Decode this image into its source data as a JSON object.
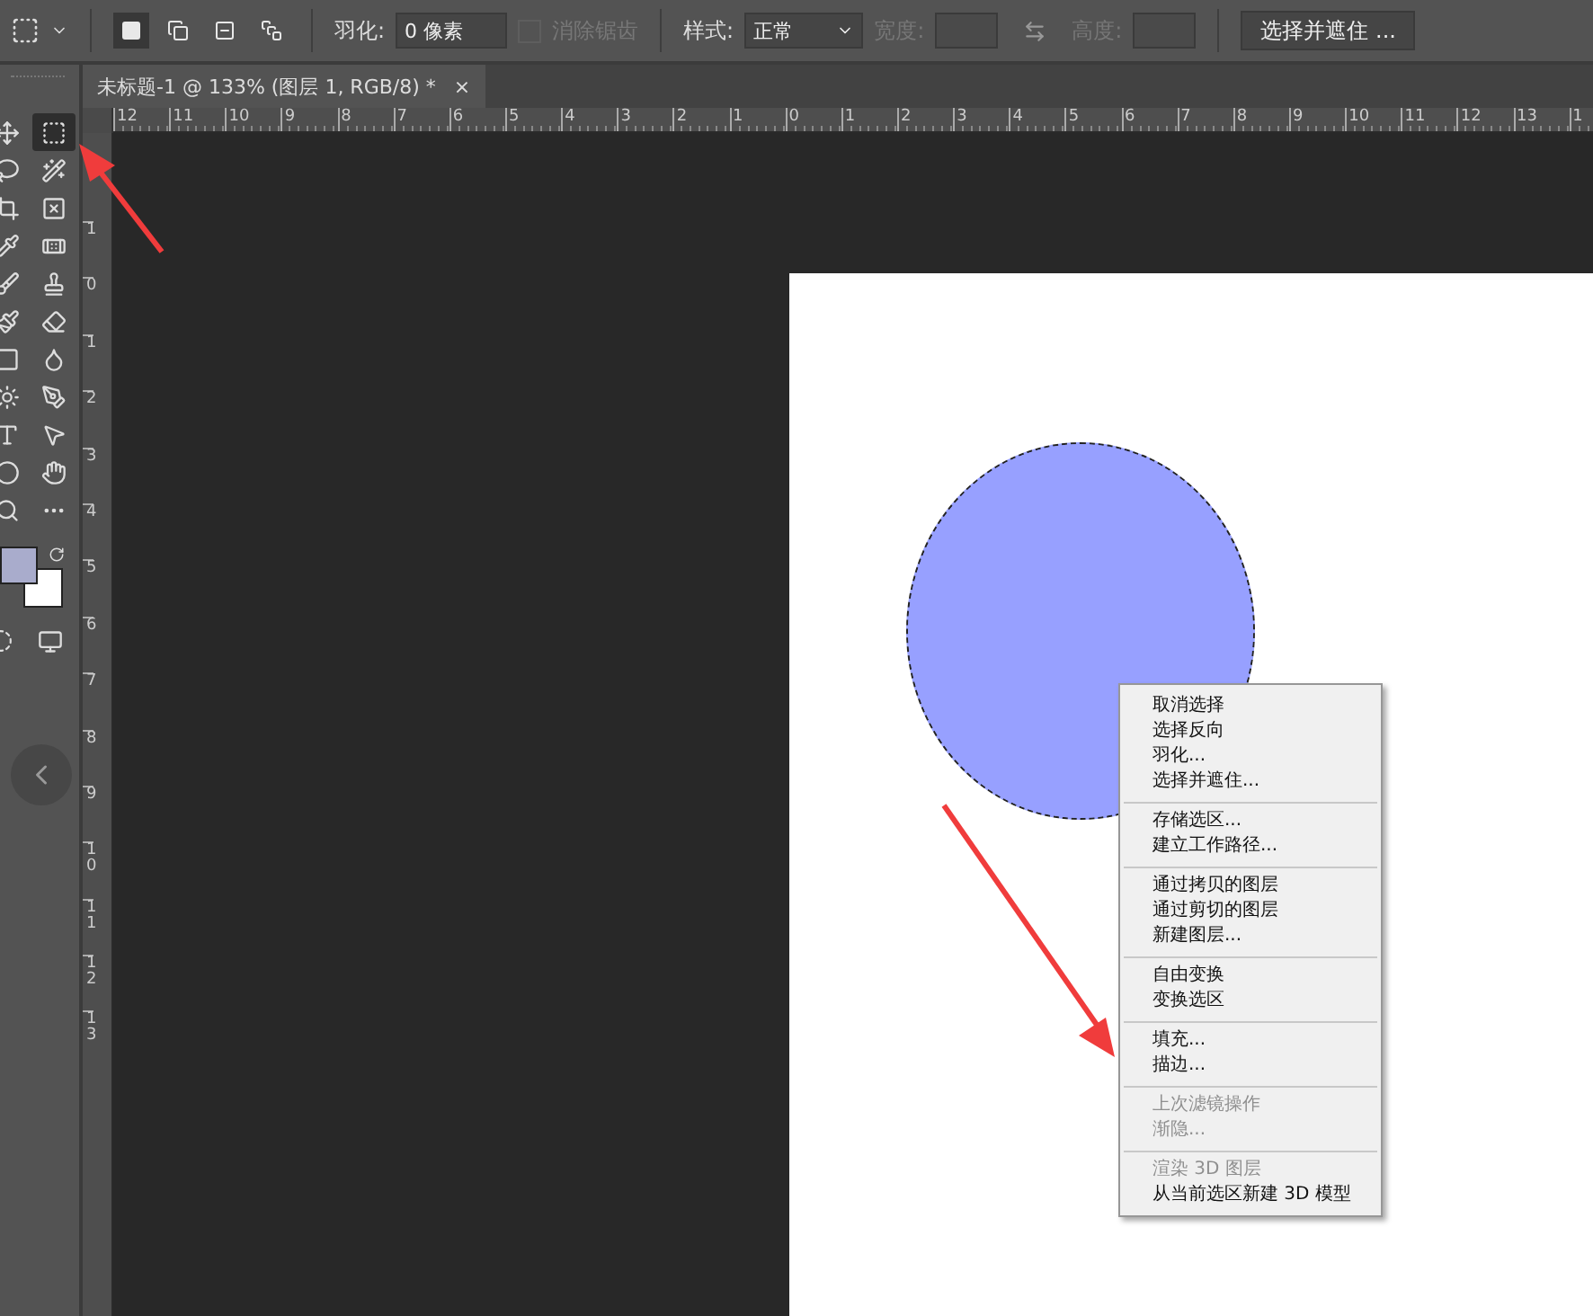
{
  "options_bar": {
    "modes": [
      {
        "selected": true
      },
      {
        "selected": false
      },
      {
        "selected": false
      },
      {
        "selected": false
      }
    ],
    "feather": {
      "label": "羽化:",
      "value": "0 像素"
    },
    "anti_alias": {
      "label": "消除锯齿",
      "checked": false,
      "disabled": true
    },
    "style": {
      "label": "样式:",
      "value": "正常"
    },
    "width": {
      "label": "宽度:",
      "disabled": true
    },
    "height": {
      "label": "高度:",
      "disabled": true
    },
    "button": "选择并遮住 ..."
  },
  "tools": [
    {
      "selected": false
    },
    {
      "selected": true
    },
    {
      "selected": false
    },
    {
      "selected": false
    },
    {
      "selected": false
    },
    {
      "selected": false
    },
    {
      "selected": false
    },
    {
      "selected": false
    },
    {
      "selected": false
    },
    {
      "selected": false
    },
    {
      "selected": false
    },
    {
      "selected": false
    },
    {
      "selected": false
    },
    {
      "selected": false
    },
    {
      "selected": false
    },
    {
      "selected": false
    },
    {
      "selected": false
    },
    {
      "selected": false
    },
    {
      "selected": false
    },
    {
      "selected": false
    },
    {
      "selected": false
    },
    {
      "selected": false
    }
  ],
  "document_tab": {
    "title": "未标题-1 @ 133% (图层 1, RGB/8) *",
    "close": "×"
  },
  "ruler_h": [
    "12",
    "11",
    "10",
    "9",
    "8",
    "7",
    "6",
    "5",
    "4",
    "3",
    "2",
    "1",
    "0",
    "1",
    "2",
    "3",
    "4",
    "5",
    "6",
    "7",
    "8",
    "9",
    "10",
    "11",
    "12",
    "13",
    "1"
  ],
  "ruler_v": [
    "1",
    "0",
    "1",
    "2",
    "3",
    "4",
    "5",
    "6",
    "7",
    "8",
    "9",
    "10",
    "11",
    "12",
    "13"
  ],
  "context_menu": [
    {
      "items": [
        {
          "label": "取消选择",
          "disabled": false
        },
        {
          "label": "选择反向",
          "disabled": false
        },
        {
          "label": "羽化...",
          "disabled": false
        },
        {
          "label": "选择并遮住...",
          "disabled": false
        }
      ]
    },
    {
      "items": [
        {
          "label": "存储选区...",
          "disabled": false
        },
        {
          "label": "建立工作路径...",
          "disabled": false
        }
      ]
    },
    {
      "items": [
        {
          "label": "通过拷贝的图层",
          "disabled": false
        },
        {
          "label": "通过剪切的图层",
          "disabled": false
        },
        {
          "label": "新建图层...",
          "disabled": false
        }
      ]
    },
    {
      "items": [
        {
          "label": "自由变换",
          "disabled": false
        },
        {
          "label": "变换选区",
          "disabled": false
        }
      ]
    },
    {
      "items": [
        {
          "label": "填充...",
          "disabled": false
        },
        {
          "label": "描边...",
          "disabled": false
        }
      ]
    },
    {
      "items": [
        {
          "label": "上次滤镜操作",
          "disabled": true
        },
        {
          "label": "渐隐...",
          "disabled": true
        }
      ]
    },
    {
      "items": [
        {
          "label": "渲染 3D 图层",
          "disabled": true
        },
        {
          "label": "从当前选区新建 3D 模型",
          "disabled": false
        }
      ]
    }
  ]
}
